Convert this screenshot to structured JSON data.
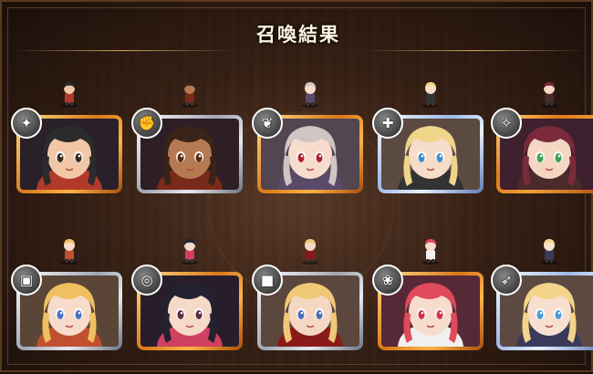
{
  "screen": {
    "title": "召喚結果"
  },
  "results": [
    {
      "rarity": "gold",
      "class_icon": "claw-icon",
      "skin": "#f2c7a8",
      "hair": "#2b2b2b",
      "eyes": "#3a2a20",
      "outfit": "#b13a2a"
    },
    {
      "rarity": "silver",
      "class_icon": "fist-icon",
      "skin": "#b57a52",
      "hair": "#3a2418",
      "eyes": "#5a2a10",
      "outfit": "#7a2a1a"
    },
    {
      "rarity": "gold",
      "class_icon": "wing-icon",
      "skin": "#f7dccd",
      "hair": "#cfc5c2",
      "eyes": "#b02030",
      "outfit": "#5a4a6a"
    },
    {
      "rarity": "plat",
      "class_icon": "sword-cross-icon",
      "skin": "#f6ddc9",
      "hair": "#f0d58a",
      "eyes": "#3c8fd0",
      "outfit": "#333333"
    },
    {
      "rarity": "black",
      "class_icon": "staff-icon",
      "skin": "#f5d6c2",
      "hair": "#7a2a3a",
      "eyes": "#3aa05a",
      "outfit": "#4a2a2a"
    },
    {
      "rarity": "silver",
      "class_icon": "box-icon",
      "skin": "#f7dccc",
      "hair": "#f0c060",
      "eyes": "#4a70c0",
      "outfit": "#c05030"
    },
    {
      "rarity": "gold",
      "class_icon": "coin-icon",
      "skin": "#f6dac8",
      "hair": "#222230",
      "eyes": "#5a2a40",
      "outfit": "#d04060"
    },
    {
      "rarity": "silver",
      "class_icon": "cannon-icon",
      "skin": "#f5d8c4",
      "hair": "#f0c878",
      "eyes": "#4a6fb0",
      "outfit": "#8a1a1a"
    },
    {
      "rarity": "gold",
      "class_icon": "ribbon-icon",
      "skin": "#f7dccd",
      "hair": "#e04a5a",
      "eyes": "#d03050",
      "outfit": "#f0f0f0"
    },
    {
      "rarity": "plat",
      "class_icon": "blade-icon",
      "skin": "#f7e0d0",
      "hair": "#f3d48a",
      "eyes": "#4a9ad8",
      "outfit": "#3a3a5a"
    }
  ]
}
